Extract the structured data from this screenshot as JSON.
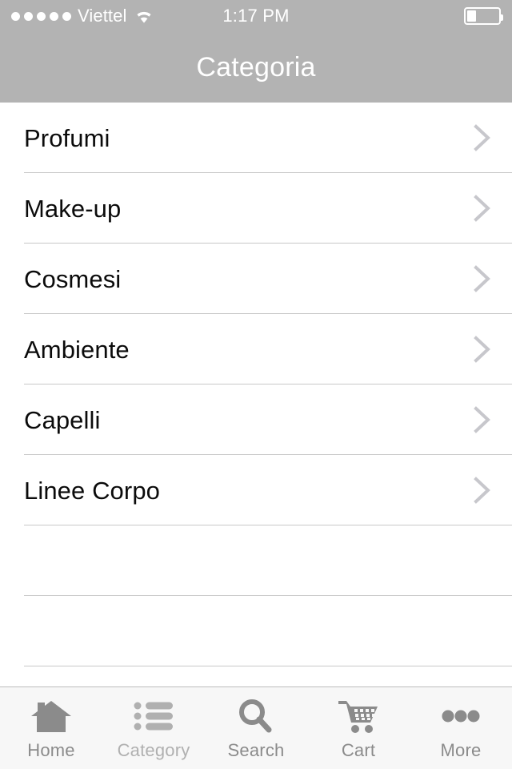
{
  "status_bar": {
    "signal_dots": 5,
    "carrier": "Viettel",
    "wifi_icon": "wifi-icon",
    "time": "1:17 PM",
    "battery_icon": "battery-icon",
    "battery_percent": 28
  },
  "header": {
    "title": "Categoria",
    "background_color": "#b3b3b3",
    "title_color": "#ffffff"
  },
  "list": {
    "separator_color": "#c8c8c8",
    "chevron_icon": "chevron-right-icon",
    "chevron_color": "#c7c7cc",
    "items": [
      {
        "label": "Profumi"
      },
      {
        "label": "Make-up"
      },
      {
        "label": "Cosmesi"
      },
      {
        "label": "Ambiente"
      },
      {
        "label": "Capelli"
      },
      {
        "label": "Linee Corpo"
      }
    ],
    "empty_rows": 3
  },
  "tabbar": {
    "background_color": "#f7f7f7",
    "inactive_color": "#8b8b8b",
    "active_color": "#b0b0b0",
    "tabs": [
      {
        "label": "Home",
        "icon": "home-icon",
        "active": false
      },
      {
        "label": "Category",
        "icon": "list-icon",
        "active": true
      },
      {
        "label": "Search",
        "icon": "search-icon",
        "active": false
      },
      {
        "label": "Cart",
        "icon": "cart-icon",
        "active": false
      },
      {
        "label": "More",
        "icon": "ellipsis-icon",
        "active": false
      }
    ]
  }
}
